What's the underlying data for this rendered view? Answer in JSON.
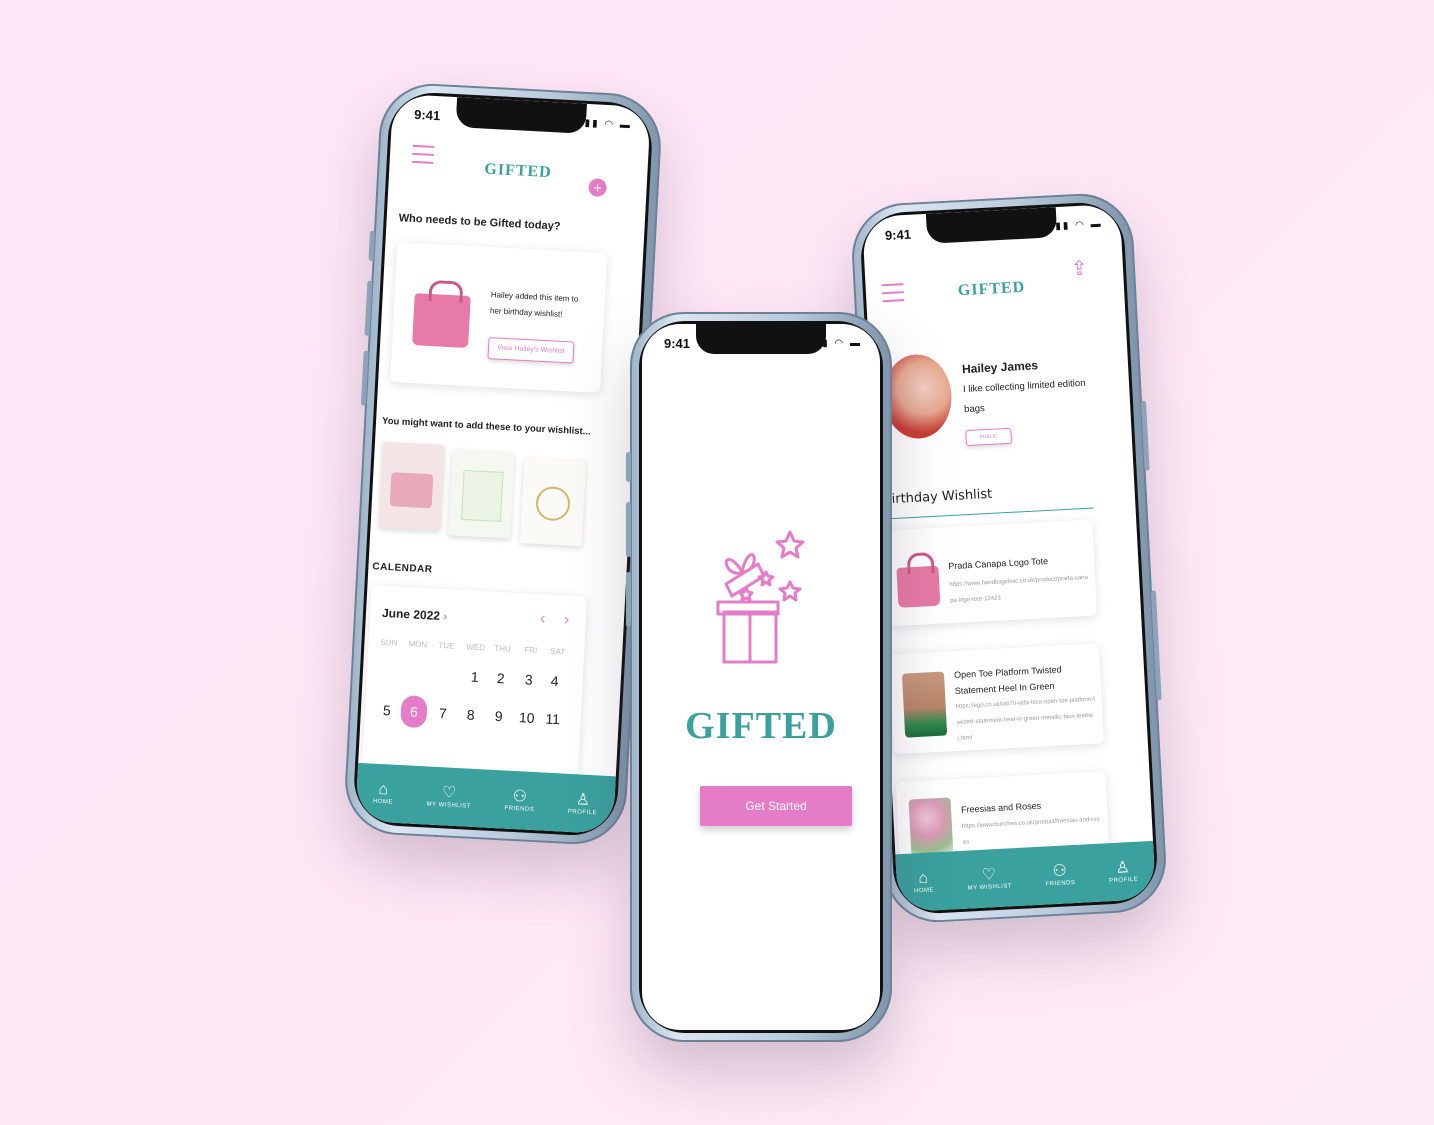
{
  "status": {
    "time": "9:41"
  },
  "brand": {
    "name": "GIFTED",
    "accent": "#e57cc7",
    "teal": "#3aa19e"
  },
  "left": {
    "prompt": "Who needs to be Gifted today?",
    "notice": "Hailey added this item to her birthday wishlist!",
    "view_button": "View Hailey's Wishlist",
    "suggest_title": "You might want to add these to your wishlist...",
    "calendar_title": "CALENDAR",
    "month": "June 2022",
    "weekdays": [
      "SUN",
      "MON",
      "TUE",
      "WED",
      "THU",
      "FRI",
      "SAT"
    ],
    "row1": [
      "1",
      "2",
      "3",
      "4"
    ],
    "row2": [
      "5",
      "6",
      "7",
      "8",
      "9",
      "10",
      "11"
    ],
    "selected_day": "6"
  },
  "center": {
    "logo": "GIFTED",
    "cta": "Get Started"
  },
  "right": {
    "name": "Hailey James",
    "bio": "I like collecting limited edition bags",
    "visibility": "PUBLIC",
    "wishlist_title": "Birthday Wishlist",
    "items": [
      {
        "title": "Prada Canapa Logo Tote",
        "url": "https://www.handbagclinic.co.uk/product/prada-canapa-logo-tote-12423"
      },
      {
        "title": "Open Toe Platform Twisted Statement Heel In Green",
        "url": "https://ego.co.uk/tati70-vida-loca-open-toe-platform-twisted-statement-heel-in-green-metallic-faux-leather.html"
      },
      {
        "title": "Freesias and Roses",
        "url": "https://www.bunches.co.uk/product/freesias-and-roses"
      }
    ]
  },
  "tabs": [
    "HOME",
    "MY WISHLIST",
    "FRIENDS",
    "PROFILE"
  ]
}
